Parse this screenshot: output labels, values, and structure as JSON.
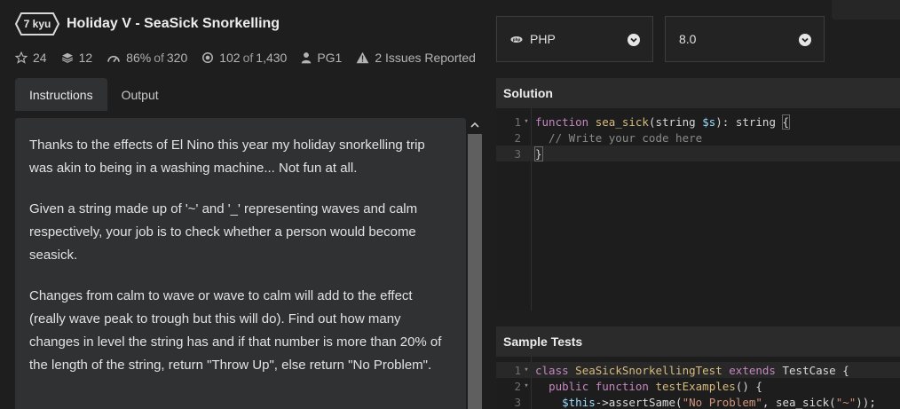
{
  "kata": {
    "rank": "7 kyu",
    "title": "Holiday V - SeaSick Snorkelling"
  },
  "stats": {
    "stars": "24",
    "collections": "12",
    "satisfaction_pct": "86%",
    "satisfaction_of": "of",
    "satisfaction_votes": "320",
    "completed": "102",
    "completed_of": "of",
    "completed_total": "1,430",
    "author": "PG1",
    "issues": "2 Issues Reported"
  },
  "tabs": {
    "instructions": "Instructions",
    "output": "Output"
  },
  "description": {
    "p1": "Thanks to the effects of El Nino this year my holiday snorkelling trip was akin to being in a washing machine... Not fun at all.",
    "p2": "Given a string made up of '~' and '_' representing waves and calm respectively, your job is to check whether a person would become seasick.",
    "p3": "Changes from calm to wave or wave to calm will add to the effect (really wave peak to trough but this will do). Find out how many changes in level the string has and if that number is more than 20% of the length of the string, return \"Throw Up\", else return \"No Problem\"."
  },
  "language_select": {
    "value": "PHP",
    "icon": "php-icon"
  },
  "version_select": {
    "value": "8.0"
  },
  "solution": {
    "header": "Solution",
    "line_numbers": [
      "1",
      "2",
      "3"
    ],
    "l1_kw": "function",
    "l1_fn": "sea_sick",
    "l1_open": "(string ",
    "l1_var": "$s",
    "l1_close": "): string ",
    "l1_brace": "{",
    "l2_comment": "  // Write your code here",
    "l3_brace": "}"
  },
  "sample_tests": {
    "header": "Sample Tests",
    "line_numbers": [
      "1",
      "2",
      "3"
    ],
    "l1_kw": "class",
    "l1_cls": "SeaSickSnorkellingTest",
    "l1_ext": "extends",
    "l1_rest": "TestCase {",
    "l2_kw1": "public",
    "l2_kw2": "function",
    "l2_fn": "testExamples",
    "l2_rest": "() {",
    "l3_var": "$this",
    "l3_call": "->assertSame(",
    "l3_str1": "\"No Problem\"",
    "l3_mid": ", sea_sick(",
    "l3_str2": "\"~\"",
    "l3_end": "));"
  }
}
